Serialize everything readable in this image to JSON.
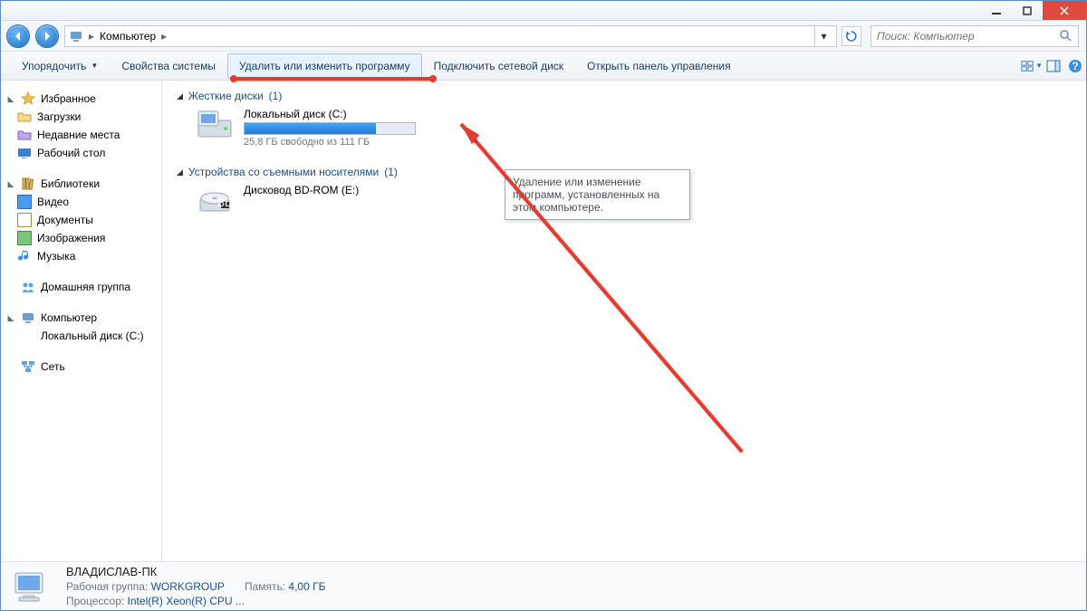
{
  "address": {
    "location": "Компьютер",
    "search_placeholder": "Поиск: Компьютер"
  },
  "commands": {
    "organize": "Упорядочить",
    "sysprops": "Свойства системы",
    "uninstall": "Удалить или изменить программу",
    "mapdrive": "Подключить сетевой диск",
    "controlpanel": "Открыть панель управления"
  },
  "tooltip": {
    "text": "Удаление или изменение программ, установленных на этом компьютере."
  },
  "sidebar": {
    "favorites": {
      "label": "Избранное",
      "items": [
        "Загрузки",
        "Недавние места",
        "Рабочий стол"
      ]
    },
    "libraries": {
      "label": "Библиотеки",
      "items": [
        "Видео",
        "Документы",
        "Изображения",
        "Музыка"
      ]
    },
    "homegroup": {
      "label": "Домашняя группа"
    },
    "computer": {
      "label": "Компьютер",
      "items": [
        "Локальный диск (C:)"
      ]
    },
    "network": {
      "label": "Сеть"
    }
  },
  "content": {
    "hdd": {
      "header": "Жесткие диски",
      "count": "(1)",
      "drive": {
        "name": "Локальный диск (C:)",
        "stat": "25,8 ГБ свободно из 111 ГБ",
        "fill_pct": 77
      }
    },
    "removable": {
      "header": "Устройства со съемными носителями",
      "count": "(1)",
      "drive": {
        "name": "Дисковод BD-ROM (E:)"
      }
    }
  },
  "status": {
    "name": "ВЛАДИСЛАВ-ПК",
    "wg_label": "Рабочая группа:",
    "wg": "WORKGROUP",
    "mem_label": "Память:",
    "mem": "4,00 ГБ",
    "cpu_label": "Процессор:",
    "cpu": "Intel(R) Xeon(R) CPU    ..."
  }
}
